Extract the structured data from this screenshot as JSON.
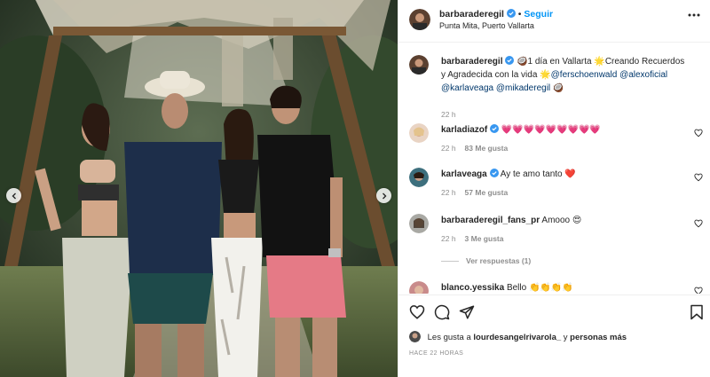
{
  "post": {
    "author": "barbaraderegil",
    "follow_label": "Seguir",
    "separator": "•",
    "location": "Punta Mita, Puerto Vallarta"
  },
  "caption": {
    "username": "barbaraderegil",
    "text_prefix": "🥥1 día en Vallarta 🌟Creando Recuerdos y Agradecida con la vida 🌟",
    "mentions": [
      "@ferschoenwald",
      "@alexoficial",
      "@karlaveaga",
      "@mikaderegil"
    ],
    "text_suffix": " 🥥",
    "time": "22 h"
  },
  "comments": [
    {
      "username": "karladiazof",
      "verified": true,
      "text": "💗💗💗💗💗💗💗💗💗",
      "time": "22 h",
      "likes": "83 Me gusta"
    },
    {
      "username": "karlaveaga",
      "verified": true,
      "text": "Ay te amo tanto ❤️",
      "time": "22 h",
      "likes": "57 Me gusta"
    },
    {
      "username": "barbaraderegil_fans_pr",
      "verified": false,
      "text": "Amooo 😍",
      "time": "22 h",
      "likes": "3 Me gusta",
      "replies": "Ver respuestas (1)"
    },
    {
      "username": "blanco.yessika",
      "verified": false,
      "text": "Bello 👏👏👏👏",
      "time": "",
      "likes": ""
    }
  ],
  "likes_line": {
    "prefix": "Les gusta a",
    "user": "lourdesangelrivarola_",
    "middle": "y",
    "others": "personas más"
  },
  "timestamp": "HACE 22 HORAS",
  "icons": {
    "verified": "verified-badge-icon",
    "more": "more-options-icon",
    "heart": "heart-icon",
    "comment": "comment-icon",
    "share": "share-icon",
    "save": "bookmark-icon",
    "carousel_prev": "chevron-left-icon",
    "carousel_next": "chevron-right-icon"
  },
  "colors": {
    "link_blue": "#0095f6",
    "verified_blue": "#3897f0",
    "mention": "#00376b",
    "muted": "#8e8e8e",
    "text": "#262626"
  }
}
